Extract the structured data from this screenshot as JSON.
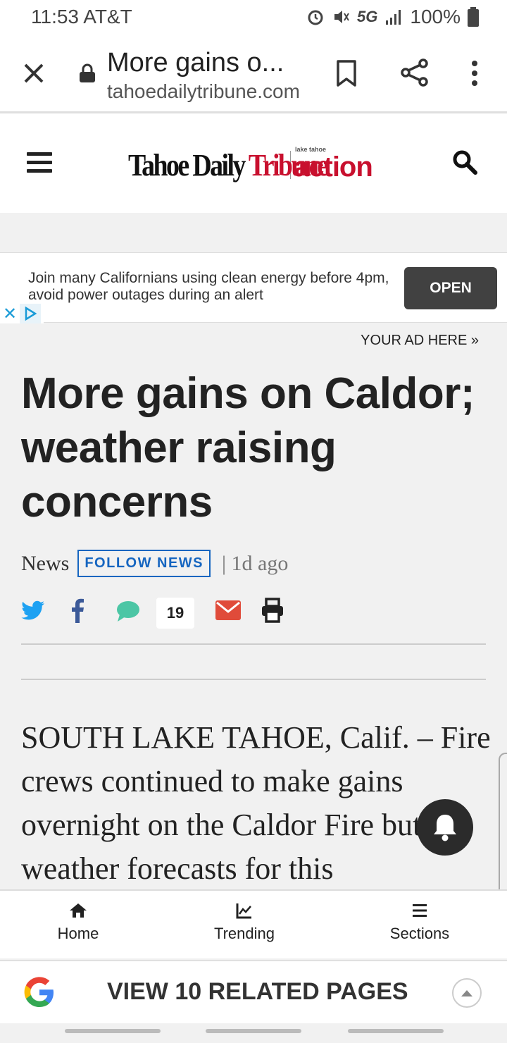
{
  "status": {
    "time": "11:53 AT&T",
    "network": "5G",
    "battery": "100%"
  },
  "toolbar": {
    "title": "More gains o...",
    "url": "tahoedailytribune.com"
  },
  "site": {
    "logo_text_1": "Tahoe Daily ",
    "logo_text_2": "Tribune",
    "logo_small": "lake tahoe",
    "logo_action": "action"
  },
  "ad": {
    "text": "Join many Californians using clean energy before 4pm, avoid power outages during an alert",
    "button": "OPEN"
  },
  "your_ad": "YOUR AD HERE »",
  "article": {
    "headline": "More gains on Caldor; weather raising concerns",
    "section": "News",
    "follow": "FOLLOW NEWS",
    "time": "| 1d ago",
    "comments": "19",
    "body": "SOUTH LAKE TAHOE, Calif. – Fire crews continued to make gains overnight on the Caldor Fire but weather forecasts for this"
  },
  "bottom_nav": [
    {
      "label": "Home",
      "icon": "home-icon"
    },
    {
      "label": "Trending",
      "icon": "trending-icon"
    },
    {
      "label": "Sections",
      "icon": "menu-icon"
    }
  ],
  "related": {
    "label": "VIEW 10 RELATED PAGES"
  },
  "colors": {
    "brand_red": "#c8102e",
    "twitter": "#1da1f2",
    "facebook": "#3b5998",
    "comment": "#4cc6a5",
    "email": "#e04b3a",
    "follow_blue": "#1565c0"
  }
}
